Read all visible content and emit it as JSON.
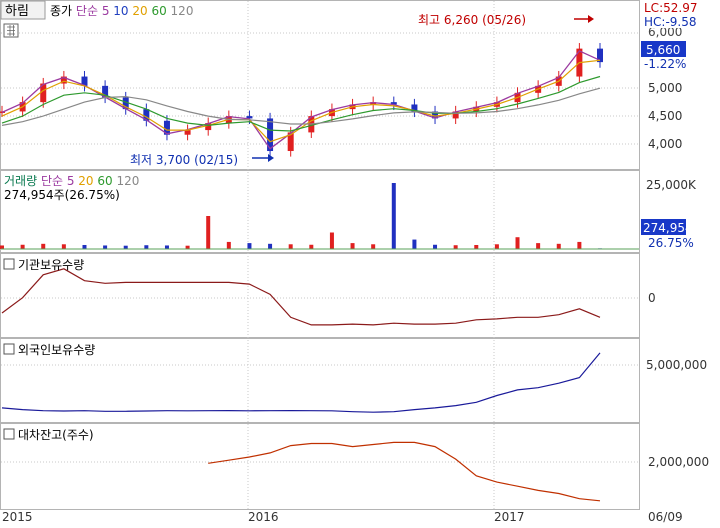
{
  "stock": {
    "name": "하림",
    "legend": [
      {
        "text": "종가",
        "color": "#000000"
      },
      {
        "text": "단순",
        "color": "#9b3aa0"
      },
      {
        "text": "5",
        "color": "#9b3aa0"
      },
      {
        "text": "10",
        "color": "#1f3fbf"
      },
      {
        "text": "20",
        "color": "#e0a000"
      },
      {
        "text": "60",
        "color": "#2e9a2e"
      },
      {
        "text": "120",
        "color": "#888888"
      }
    ],
    "lc_label": "LC:52.97",
    "hc_label": "HC:-9.58",
    "high_label": "최고 6,260 (05/26)",
    "low_label": "최저 3,700 (02/15)",
    "current_price_label": "5,660",
    "change_label": "-1.22%",
    "top_clipped_tick": "6,000",
    "y_ticks": [
      "5,000",
      "4,500",
      "4,000"
    ]
  },
  "volume": {
    "title": "거래량",
    "legend": [
      {
        "text": "단순",
        "color": "#9b3aa0"
      },
      {
        "text": "5",
        "color": "#9b3aa0"
      },
      {
        "text": "20",
        "color": "#e0a000"
      },
      {
        "text": "60",
        "color": "#2e9a2e"
      },
      {
        "text": "120",
        "color": "#888888"
      }
    ],
    "current_label": "274,954주(26.75%)",
    "tick": "25,000K",
    "current_value": "274,954",
    "current_pct": "26.75%"
  },
  "inst": {
    "title": "기관보유수량",
    "tick": "0"
  },
  "foreign": {
    "title": "외국인보유수량",
    "tick": "5,000,000"
  },
  "loan": {
    "title": "대차잔고(주수)",
    "tick": "2,000,000"
  },
  "x_labels": [
    "2015",
    "2016",
    "2017",
    "06/09"
  ],
  "colors": {
    "up": "#e02020",
    "down": "#2030c0",
    "ma5": "#9b3aa0",
    "ma10": "#1f3fbf",
    "ma20": "#e0a000",
    "ma60": "#2e9a2e",
    "ma120": "#888888",
    "inst_line": "#8b1a1a",
    "foreign_line": "#1a1a9a",
    "loan_line": "#c03000",
    "grid": "#c8c8c8",
    "price_box": "#1838c8"
  },
  "chart_data": [
    {
      "type": "line",
      "title": "하림",
      "series_kind": "price",
      "x": [
        "2015-01",
        "2015-02",
        "2015-03",
        "2015-04",
        "2015-05",
        "2015-06",
        "2015-07",
        "2015-08",
        "2015-09",
        "2015-10",
        "2015-11",
        "2015-12",
        "2016-01",
        "2016-02",
        "2016-03",
        "2016-04",
        "2016-05",
        "2016-06",
        "2016-07",
        "2016-08",
        "2016-09",
        "2016-10",
        "2016-11",
        "2016-12",
        "2017-01",
        "2017-02",
        "2017-03",
        "2017-04",
        "2017-05",
        "2017-06"
      ],
      "series": [
        {
          "name": "종가",
          "values": [
            4600,
            4800,
            5200,
            5350,
            5150,
            4900,
            4650,
            4400,
            4100,
            4200,
            4350,
            4500,
            4450,
            3750,
            4150,
            4500,
            4650,
            4750,
            4800,
            4750,
            4600,
            4450,
            4600,
            4700,
            4800,
            5000,
            5150,
            5350,
            5950,
            5660
          ]
        },
        {
          "name": "5",
          "values": [
            4580,
            4780,
            5180,
            5330,
            5160,
            4910,
            4660,
            4420,
            4120,
            4210,
            4340,
            4490,
            4440,
            3800,
            4130,
            4480,
            4640,
            4740,
            4790,
            4750,
            4610,
            4460,
            4590,
            4690,
            4790,
            4990,
            5140,
            5330,
            5900,
            5700
          ]
        },
        {
          "name": "20",
          "values": [
            4500,
            4700,
            5050,
            5250,
            5150,
            4950,
            4700,
            4480,
            4200,
            4200,
            4300,
            4430,
            4420,
            3950,
            4100,
            4400,
            4580,
            4700,
            4750,
            4720,
            4620,
            4500,
            4560,
            4650,
            4750,
            4900,
            5080,
            5250,
            5650,
            5700
          ]
        },
        {
          "name": "60",
          "values": [
            4350,
            4500,
            4750,
            4950,
            5000,
            4950,
            4800,
            4650,
            4450,
            4350,
            4300,
            4350,
            4380,
            4200,
            4180,
            4300,
            4420,
            4530,
            4620,
            4660,
            4620,
            4560,
            4560,
            4600,
            4660,
            4760,
            4880,
            5010,
            5220,
            5350
          ]
        },
        {
          "name": "120",
          "values": [
            4300,
            4380,
            4500,
            4650,
            4800,
            4900,
            4920,
            4850,
            4720,
            4600,
            4500,
            4430,
            4420,
            4380,
            4330,
            4330,
            4380,
            4440,
            4510,
            4570,
            4590,
            4580,
            4560,
            4570,
            4600,
            4660,
            4740,
            4840,
            4980,
            5100
          ]
        }
      ],
      "ylim": [
        3600,
        6350
      ],
      "annotations": [
        "최고 6,260 (05/26)",
        "최저 3,700 (02/15)"
      ]
    },
    {
      "type": "bar",
      "title": "거래량",
      "series_kind": "volume",
      "x": [
        "2015-01",
        "2015-02",
        "2015-03",
        "2015-04",
        "2015-05",
        "2015-06",
        "2015-07",
        "2015-08",
        "2015-09",
        "2015-10",
        "2015-11",
        "2015-12",
        "2016-01",
        "2016-02",
        "2016-03",
        "2016-04",
        "2016-05",
        "2016-06",
        "2016-07",
        "2016-08",
        "2016-09",
        "2016-10",
        "2016-11",
        "2016-12",
        "2017-01",
        "2017-02",
        "2017-03",
        "2017-04",
        "2017-05",
        "2017-06"
      ],
      "values": [
        1500,
        1800,
        2200,
        2000,
        1700,
        1500,
        1400,
        1600,
        1500,
        1400,
        14000,
        3000,
        2500,
        2200,
        2000,
        1800,
        7000,
        2500,
        2000,
        28000,
        4000,
        1800,
        1600,
        1700,
        2000,
        5000,
        2500,
        2200,
        3000,
        275
      ],
      "unit": "K",
      "ylim": [
        0,
        28000
      ]
    },
    {
      "type": "line",
      "title": "기관보유수량",
      "x": [
        "2015-01",
        "2015-02",
        "2015-03",
        "2015-04",
        "2015-05",
        "2015-06",
        "2015-07",
        "2015-08",
        "2015-09",
        "2015-10",
        "2015-11",
        "2015-12",
        "2016-01",
        "2016-02",
        "2016-03",
        "2016-04",
        "2016-05",
        "2016-06",
        "2016-07",
        "2016-08",
        "2016-09",
        "2016-10",
        "2016-11",
        "2016-12",
        "2017-01",
        "2017-02",
        "2017-03",
        "2017-04",
        "2017-05",
        "2017-06"
      ],
      "values": [
        0.1,
        0.28,
        0.55,
        0.62,
        0.48,
        0.45,
        0.46,
        0.46,
        0.46,
        0.46,
        0.46,
        0.46,
        0.44,
        0.32,
        0.05,
        -0.04,
        -0.04,
        -0.03,
        -0.04,
        -0.02,
        -0.03,
        -0.03,
        -0.02,
        0.02,
        0.03,
        0.05,
        0.05,
        0.08,
        0.15,
        0.05
      ],
      "unit": "relative"
    },
    {
      "type": "line",
      "title": "외국인보유수량",
      "x": [
        "2015-01",
        "2015-02",
        "2015-03",
        "2015-04",
        "2015-05",
        "2015-06",
        "2015-07",
        "2015-08",
        "2015-09",
        "2015-10",
        "2015-11",
        "2015-12",
        "2016-01",
        "2016-02",
        "2016-03",
        "2016-04",
        "2016-05",
        "2016-06",
        "2016-07",
        "2016-08",
        "2016-09",
        "2016-10",
        "2016-11",
        "2016-12",
        "2017-01",
        "2017-02",
        "2017-03",
        "2017-04",
        "2017-05",
        "2017-06"
      ],
      "values": [
        900000,
        750000,
        650000,
        620000,
        650000,
        600000,
        600000,
        620000,
        650000,
        640000,
        650000,
        660000,
        640000,
        650000,
        660000,
        650000,
        640000,
        560000,
        520000,
        560000,
        750000,
        900000,
        1100000,
        1400000,
        2000000,
        2500000,
        2700000,
        3100000,
        3600000,
        5800000
      ],
      "ylim": [
        0,
        6500000
      ]
    },
    {
      "type": "line",
      "title": "대차잔고(주수)",
      "x": [
        "2015-01",
        "2015-02",
        "2015-03",
        "2015-04",
        "2015-05",
        "2015-06",
        "2015-07",
        "2015-08",
        "2015-09",
        "2015-10",
        "2015-11",
        "2015-12",
        "2016-01",
        "2016-02",
        "2016-03",
        "2016-04",
        "2016-05",
        "2016-06",
        "2016-07",
        "2016-08",
        "2016-09",
        "2016-10",
        "2016-11",
        "2016-12",
        "2017-01",
        "2017-02",
        "2017-03",
        "2017-04",
        "2017-05",
        "2017-06"
      ],
      "values": [
        null,
        null,
        null,
        null,
        null,
        null,
        null,
        null,
        null,
        null,
        2000000,
        2150000,
        2300000,
        2500000,
        2850000,
        2950000,
        2950000,
        2800000,
        2900000,
        3000000,
        3000000,
        2800000,
        2200000,
        1400000,
        1100000,
        900000,
        700000,
        550000,
        300000,
        200000
      ],
      "ylim": [
        0,
        3500000
      ]
    }
  ]
}
